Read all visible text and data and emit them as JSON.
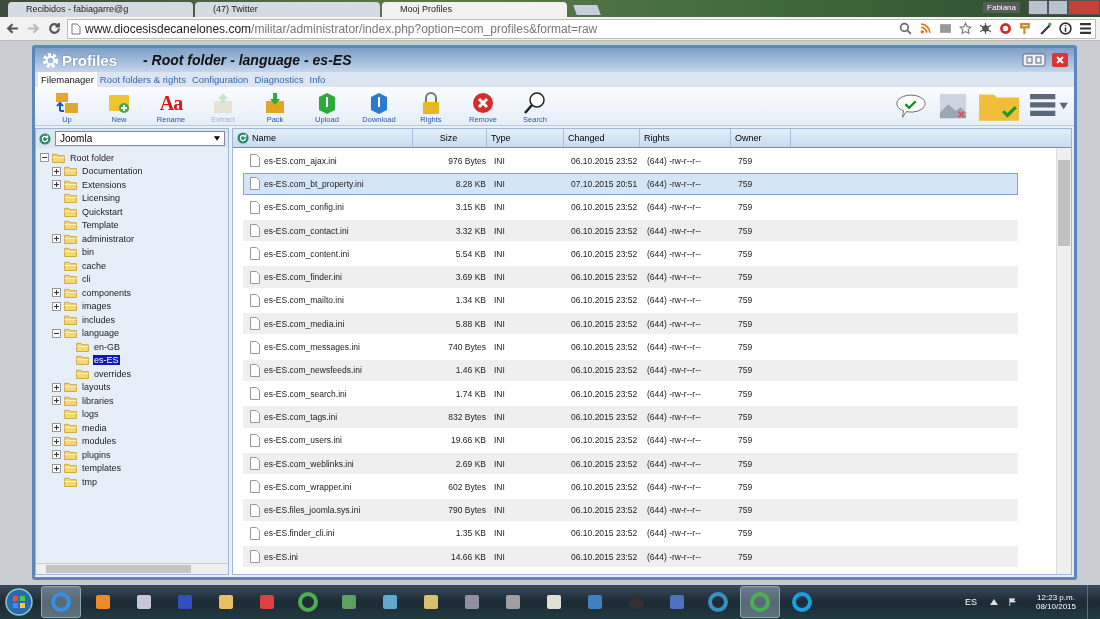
{
  "browser": {
    "tabs": [
      {
        "title": "Recibidos - fabiagarre@g",
        "selected": false
      },
      {
        "title": "(47) Twitter",
        "selected": false
      },
      {
        "title": "Mooj Profiles",
        "selected": true
      }
    ],
    "user": "Fabiana",
    "url_host": "www.diocesisdecanelones.com",
    "url_path": "/militar/administrator/index.php?option=com_profiles&format=raw"
  },
  "app": {
    "logo": "Profiles",
    "title": "- Root folder - language - es-ES",
    "tabs": [
      {
        "label": "Filemanager",
        "selected": true
      },
      {
        "label": "Root folders & rights",
        "selected": false
      },
      {
        "label": "Configuration",
        "selected": false
      },
      {
        "label": "Diagnostics",
        "selected": false
      },
      {
        "label": "Info",
        "selected": false
      }
    ],
    "toolbar": [
      {
        "label": "Up",
        "disabled": false
      },
      {
        "label": "New",
        "disabled": false
      },
      {
        "label": "Rename",
        "disabled": false,
        "glyph": "Aa"
      },
      {
        "label": "Extract",
        "disabled": true
      },
      {
        "label": "Pack",
        "disabled": false
      },
      {
        "label": "Upload",
        "disabled": false
      },
      {
        "label": "Download",
        "disabled": false
      },
      {
        "label": "Rights",
        "disabled": false
      },
      {
        "label": "Remove",
        "disabled": false
      },
      {
        "label": "Search",
        "disabled": false
      }
    ],
    "root_select": "Joomla",
    "tree": [
      {
        "label": "Root folder",
        "kind": "branch",
        "expanded": true,
        "selected": false,
        "children": [
          {
            "label": "Documentation",
            "kind": "branch",
            "expanded": false,
            "selected": false
          },
          {
            "label": "Extensions",
            "kind": "branch",
            "expanded": false,
            "selected": false
          },
          {
            "label": "Licensing",
            "kind": "leaf",
            "selected": false
          },
          {
            "label": "Quickstart",
            "kind": "leaf",
            "selected": false
          },
          {
            "label": "Template",
            "kind": "leaf",
            "selected": false
          },
          {
            "label": "administrator",
            "kind": "branch",
            "expanded": false,
            "selected": false
          },
          {
            "label": "bin",
            "kind": "leaf",
            "selected": false
          },
          {
            "label": "cache",
            "kind": "leaf",
            "selected": false
          },
          {
            "label": "cli",
            "kind": "leaf",
            "selected": false
          },
          {
            "label": "components",
            "kind": "branch",
            "expanded": false,
            "selected": false
          },
          {
            "label": "images",
            "kind": "branch",
            "expanded": false,
            "selected": false
          },
          {
            "label": "includes",
            "kind": "leaf",
            "selected": false
          },
          {
            "label": "language",
            "kind": "branch",
            "expanded": true,
            "selected": false,
            "children": [
              {
                "label": "en-GB",
                "kind": "leaf",
                "selected": false
              },
              {
                "label": "es-ES",
                "kind": "leaf",
                "selected": true
              },
              {
                "label": "overrides",
                "kind": "leaf",
                "selected": false
              }
            ]
          },
          {
            "label": "layouts",
            "kind": "branch",
            "expanded": false,
            "selected": false
          },
          {
            "label": "libraries",
            "kind": "branch",
            "expanded": false,
            "selected": false
          },
          {
            "label": "logs",
            "kind": "leaf",
            "selected": false
          },
          {
            "label": "media",
            "kind": "branch",
            "expanded": false,
            "selected": false
          },
          {
            "label": "modules",
            "kind": "branch",
            "expanded": false,
            "selected": false
          },
          {
            "label": "plugins",
            "kind": "branch",
            "expanded": false,
            "selected": false
          },
          {
            "label": "templates",
            "kind": "branch",
            "expanded": false,
            "selected": false
          },
          {
            "label": "tmp",
            "kind": "leaf",
            "selected": false
          }
        ]
      }
    ],
    "table": {
      "columns": [
        "Name",
        "Size",
        "Type",
        "Changed",
        "Rights",
        "Owner"
      ],
      "rows": [
        {
          "name": "es-ES.com_ajax.ini",
          "size": "976 Bytes",
          "type": "INI",
          "changed": "06.10.2015 23:52",
          "rights": "(644) -rw-r--r--",
          "owner": "759",
          "selected": false
        },
        {
          "name": "es-ES.com_bt_property.ini",
          "size": "8.28 KB",
          "type": "INI",
          "changed": "07.10.2015 20:51",
          "rights": "(644) -rw-r--r--",
          "owner": "759",
          "selected": true
        },
        {
          "name": "es-ES.com_config.ini",
          "size": "3.15 KB",
          "type": "INI",
          "changed": "06.10.2015 23:52",
          "rights": "(644) -rw-r--r--",
          "owner": "759",
          "selected": false
        },
        {
          "name": "es-ES.com_contact.ini",
          "size": "3.32 KB",
          "type": "INI",
          "changed": "06.10.2015 23:52",
          "rights": "(644) -rw-r--r--",
          "owner": "759",
          "selected": false
        },
        {
          "name": "es-ES.com_content.ini",
          "size": "5.54 KB",
          "type": "INI",
          "changed": "06.10.2015 23:52",
          "rights": "(644) -rw-r--r--",
          "owner": "759",
          "selected": false
        },
        {
          "name": "es-ES.com_finder.ini",
          "size": "3.69 KB",
          "type": "INI",
          "changed": "06.10.2015 23:52",
          "rights": "(644) -rw-r--r--",
          "owner": "759",
          "selected": false
        },
        {
          "name": "es-ES.com_mailto.ini",
          "size": "1.34 KB",
          "type": "INI",
          "changed": "06.10.2015 23:52",
          "rights": "(644) -rw-r--r--",
          "owner": "759",
          "selected": false
        },
        {
          "name": "es-ES.com_media.ini",
          "size": "5.88 KB",
          "type": "INI",
          "changed": "06.10.2015 23:52",
          "rights": "(644) -rw-r--r--",
          "owner": "759",
          "selected": false
        },
        {
          "name": "es-ES.com_messages.ini",
          "size": "740 Bytes",
          "type": "INI",
          "changed": "06.10.2015 23:52",
          "rights": "(644) -rw-r--r--",
          "owner": "759",
          "selected": false
        },
        {
          "name": "es-ES.com_newsfeeds.ini",
          "size": "1.46 KB",
          "type": "INI",
          "changed": "06.10.2015 23:52",
          "rights": "(644) -rw-r--r--",
          "owner": "759",
          "selected": false
        },
        {
          "name": "es-ES.com_search.ini",
          "size": "1.74 KB",
          "type": "INI",
          "changed": "06.10.2015 23:52",
          "rights": "(644) -rw-r--r--",
          "owner": "759",
          "selected": false
        },
        {
          "name": "es-ES.com_tags.ini",
          "size": "832 Bytes",
          "type": "INI",
          "changed": "06.10.2015 23:52",
          "rights": "(644) -rw-r--r--",
          "owner": "759",
          "selected": false
        },
        {
          "name": "es-ES.com_users.ini",
          "size": "19.66 KB",
          "type": "INI",
          "changed": "06.10.2015 23:52",
          "rights": "(644) -rw-r--r--",
          "owner": "759",
          "selected": false
        },
        {
          "name": "es-ES.com_weblinks.ini",
          "size": "2.69 KB",
          "type": "INI",
          "changed": "06.10.2015 23:52",
          "rights": "(644) -rw-r--r--",
          "owner": "759",
          "selected": false
        },
        {
          "name": "es-ES.com_wrapper.ini",
          "size": "602 Bytes",
          "type": "INI",
          "changed": "06.10.2015 23:52",
          "rights": "(644) -rw-r--r--",
          "owner": "759",
          "selected": false
        },
        {
          "name": "es-ES.files_joomla.sys.ini",
          "size": "790 Bytes",
          "type": "INI",
          "changed": "06.10.2015 23:52",
          "rights": "(644) -rw-r--r--",
          "owner": "759",
          "selected": false
        },
        {
          "name": "es-ES.finder_cli.ini",
          "size": "1.35 KB",
          "type": "INI",
          "changed": "06.10.2015 23:52",
          "rights": "(644) -rw-r--r--",
          "owner": "759",
          "selected": false
        },
        {
          "name": "es-ES.ini",
          "size": "14.66 KB",
          "type": "INI",
          "changed": "06.10.2015 23:52",
          "rights": "(644) -rw-r--r--",
          "owner": "759",
          "selected": false
        }
      ]
    }
  },
  "taskbar": {
    "language": "ES",
    "time": "12:23 p.m.",
    "date": "08/10/2015"
  }
}
